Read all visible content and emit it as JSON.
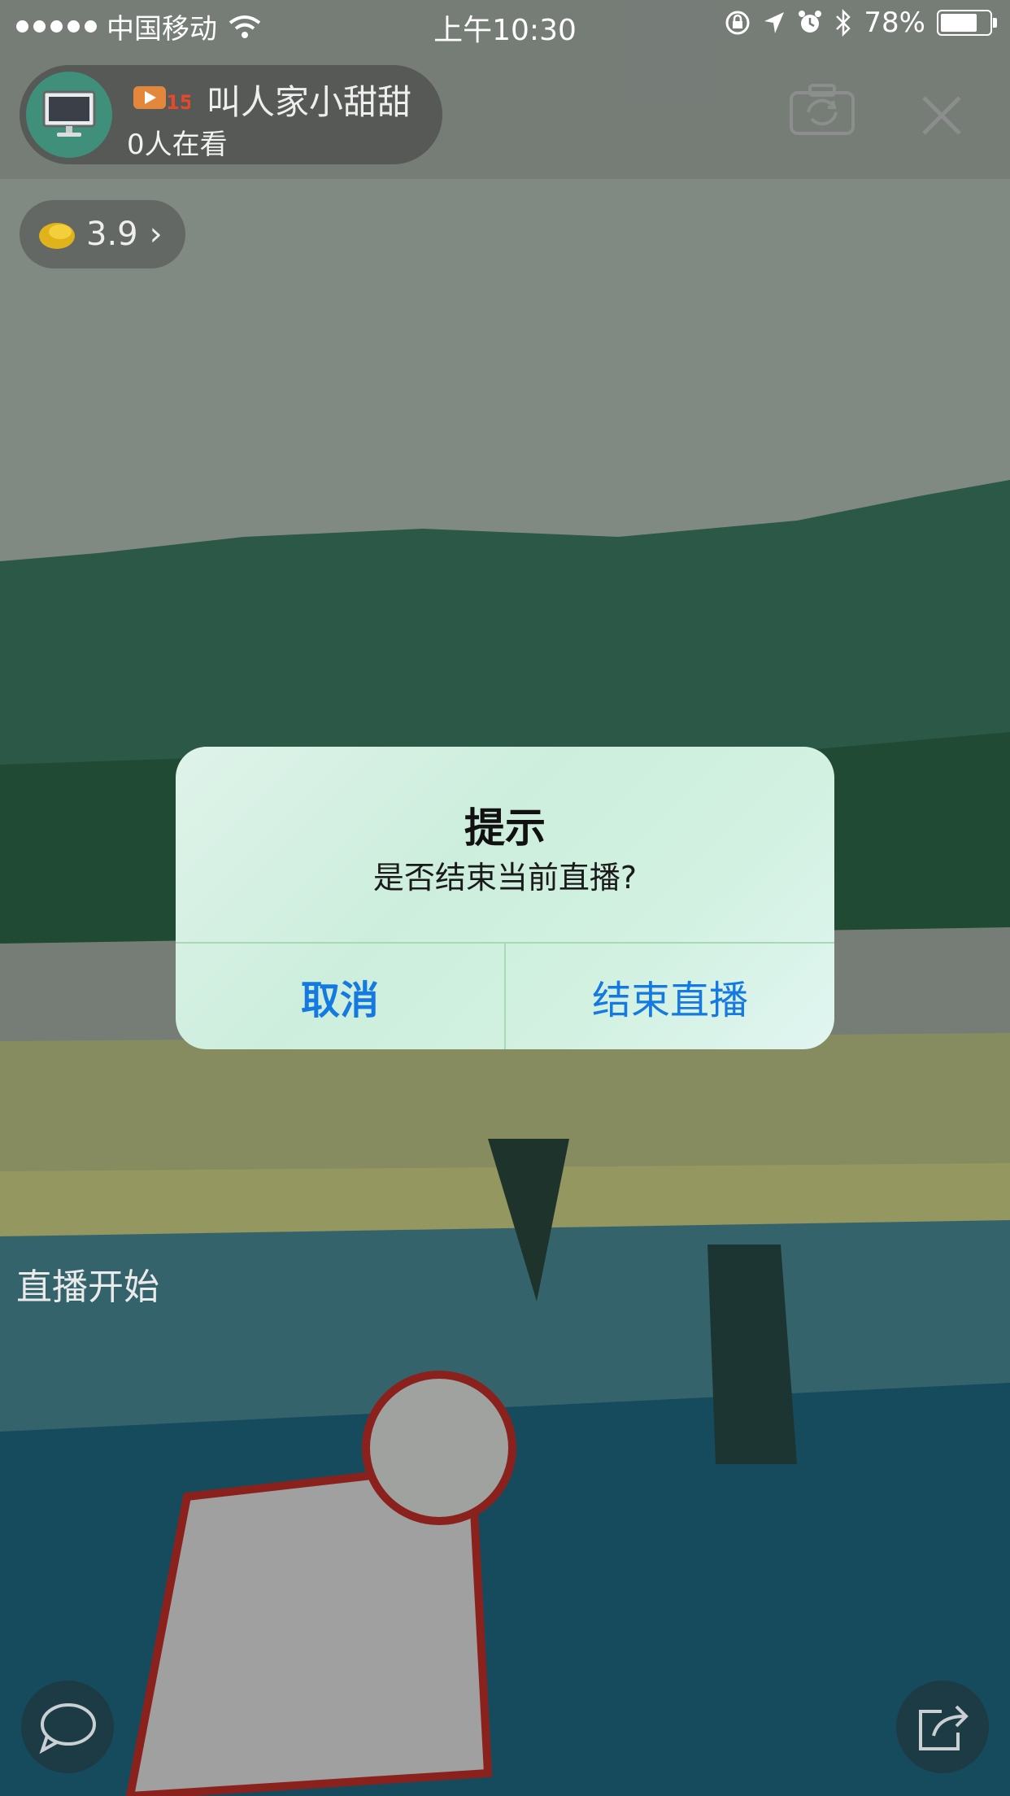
{
  "status_bar": {
    "carrier": "中国移动",
    "time": "上午10:30",
    "battery_text": "78%",
    "battery_level": 0.78
  },
  "anchor": {
    "name": "叫人家小甜甜",
    "viewers": "0人在看",
    "level": "15",
    "avatar_icon": "monitor-icon"
  },
  "coins": {
    "value": "3.9",
    "icon": "coin-icon"
  },
  "top_buttons": {
    "camera_icon": "camera-switch-icon",
    "close_icon": "close-icon"
  },
  "chat": {
    "message": "直播开始"
  },
  "bottom_buttons": {
    "chat_icon": "chat-bubble-icon",
    "share_icon": "share-icon"
  },
  "alert": {
    "title": "提示",
    "message": "是否结束当前直播?",
    "cancel_label": "取消",
    "confirm_label": "结束直播",
    "button_color": "#1479e0"
  }
}
